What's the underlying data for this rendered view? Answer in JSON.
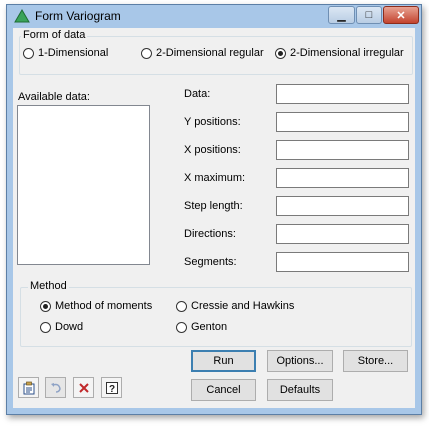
{
  "window": {
    "title": "Form Variogram",
    "minimize": "▁",
    "maximize": "□",
    "close": "✕"
  },
  "form_of_data": {
    "legend": "Form of data",
    "options": [
      "1-Dimensional",
      "2-Dimensional regular",
      "2-Dimensional irregular"
    ],
    "selected": "2-Dimensional irregular"
  },
  "available_data": {
    "label": "Available data:"
  },
  "fields": [
    {
      "label": "Data:",
      "value": ""
    },
    {
      "label": "Y positions:",
      "value": ""
    },
    {
      "label": "X positions:",
      "value": ""
    },
    {
      "label": "X maximum:",
      "value": ""
    },
    {
      "label": "Step length:",
      "value": ""
    },
    {
      "label": "Directions:",
      "value": ""
    },
    {
      "label": "Segments:",
      "value": ""
    }
  ],
  "method": {
    "legend": "Method",
    "options": [
      "Method of moments",
      "Cressie and Hawkins",
      "Dowd",
      "Genton"
    ],
    "selected": "Method of moments"
  },
  "buttons": {
    "run": "Run",
    "options": "Options...",
    "store": "Store...",
    "cancel": "Cancel",
    "defaults": "Defaults"
  },
  "icons": [
    "clipboard-icon",
    "undo-icon",
    "clear-icon",
    "help-icon"
  ],
  "colors": {
    "title_bar": "#a8c7e8",
    "dialog": "#f0f0f0",
    "close_button": "#c3442f"
  }
}
